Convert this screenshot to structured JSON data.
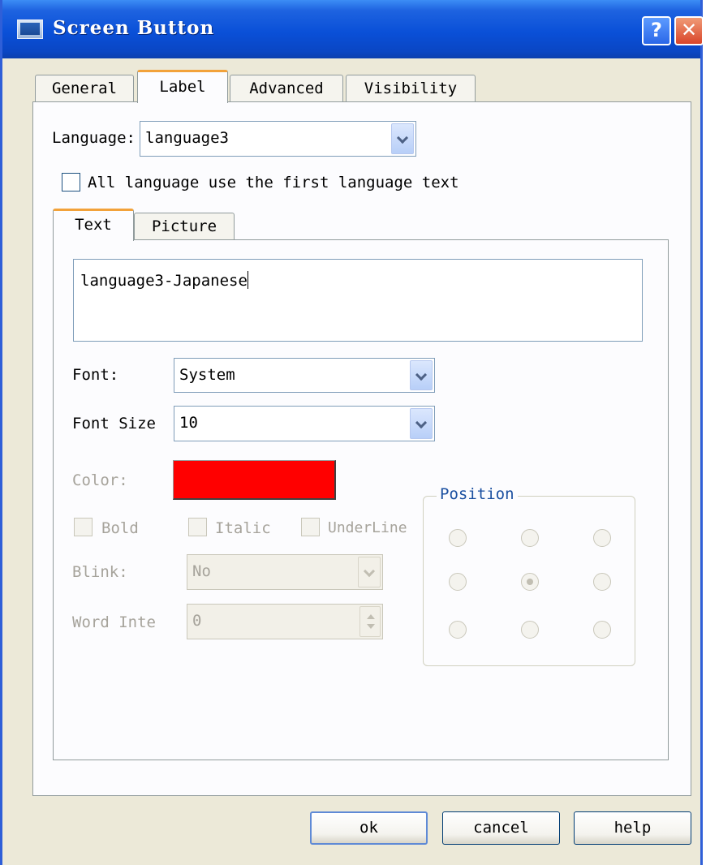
{
  "window": {
    "title": "Screen Button",
    "help_glyph": "?",
    "close_glyph": "✕"
  },
  "tabs": [
    "General",
    "Label",
    "Advanced",
    "Visibility"
  ],
  "label_tab": {
    "language_label": "Language:",
    "language_value": "language3",
    "all_language_checkbox": {
      "label": "All language use the first language text",
      "checked": false
    },
    "subtabs": [
      "Text",
      "Picture"
    ],
    "text_value": "language3-Japanese",
    "font_label": "Font:",
    "font_value": "System",
    "font_size_label": "Font Size",
    "font_size_value": "10",
    "color_label": "Color:",
    "color_value": "#ff0000",
    "style_checkboxes": [
      {
        "label": "Bold",
        "checked": false
      },
      {
        "label": "Italic",
        "checked": false
      },
      {
        "label": "UnderLine",
        "checked": false
      }
    ],
    "blink_label": "Blink:",
    "blink_value": "No",
    "word_interval_label": "Word Inte",
    "word_interval_value": "0",
    "position": {
      "title": "Position",
      "selected": "middle-center"
    }
  },
  "buttons": {
    "ok": "ok",
    "cancel": "cancel",
    "help": "help"
  }
}
